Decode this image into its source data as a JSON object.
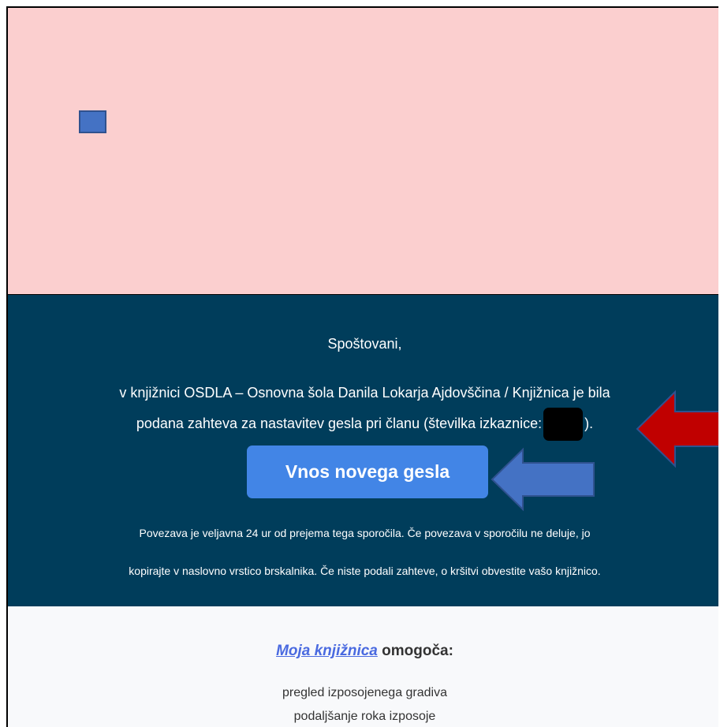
{
  "greeting": "Spoštovani,",
  "message": {
    "line1": "v knjižnici OSDLA – Osnovna šola Danila Lokarja Ajdovščina / Knjižnica je bila",
    "line2_prefix": "podana zahteva za nastavitev gesla pri članu (številka izkaznice:",
    "line2_suffix": ")."
  },
  "cta_label": "Vnos novega gesla",
  "note": {
    "line1": "Povezava je veljavna 24 ur od prejema tega sporočila. Če povezava v sporočilu ne deluje, jo",
    "line2": "kopirajte v naslovno vrstico brskalnika. Če niste podali zahteve, o kršitvi obvestite vašo knjižnico."
  },
  "footer": {
    "link_text": "Moja knjižnica",
    "title_suffix": " omogoča:",
    "features": [
      "pregled izposojenega gradiva",
      "podaljšanje roka izposoje"
    ]
  },
  "colors": {
    "hero_bg": "#fbcfcf",
    "panel_bg": "#003d5b",
    "button_bg": "#4285e6",
    "red_arrow": "#c00000",
    "blue_arrow": "#4472c4"
  },
  "icons": {
    "placeholder": "image-placeholder-icon",
    "red_arrow": "arrow-left-icon",
    "blue_arrow": "arrow-left-icon"
  }
}
